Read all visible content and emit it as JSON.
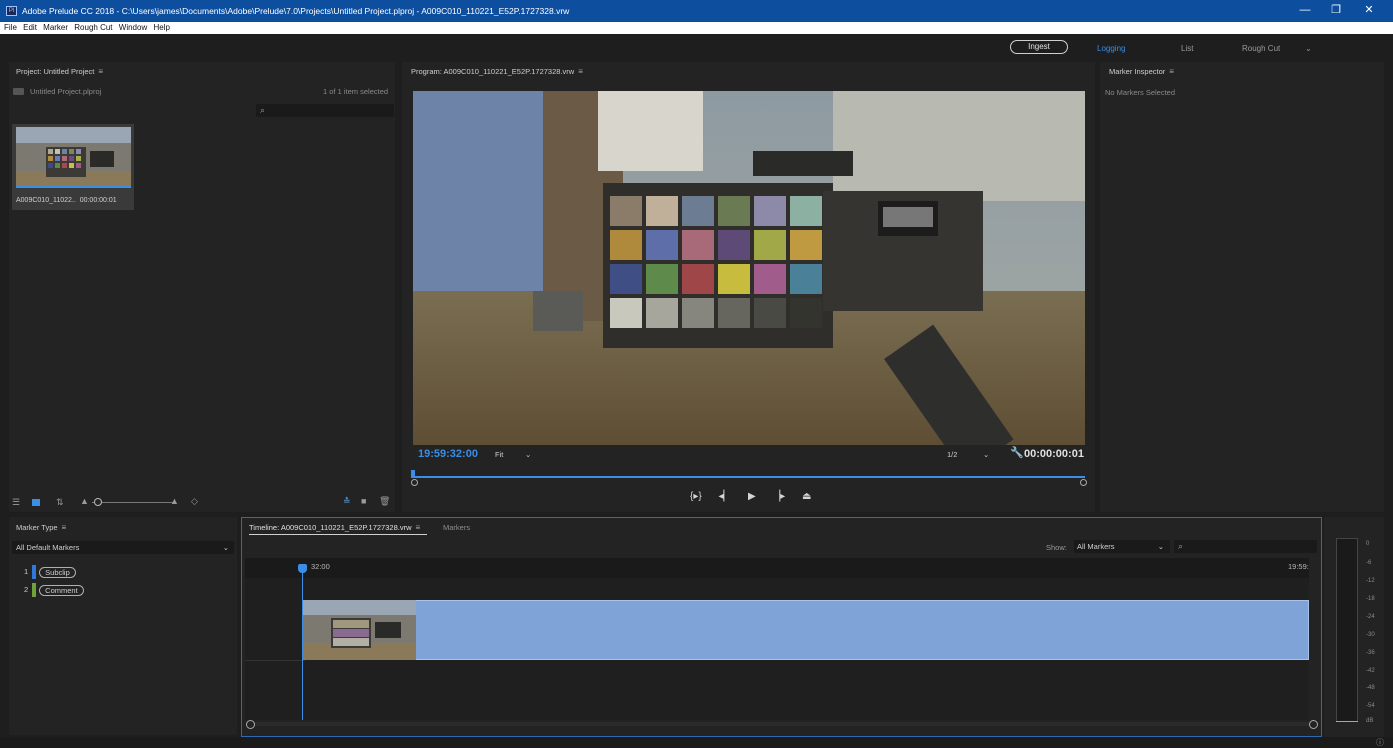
{
  "window": {
    "app_icon_label": "Pl",
    "title": "Adobe Prelude CC 2018 - C:\\Users\\james\\Documents\\Adobe\\Prelude\\7.0\\Projects\\Untitled Project.plproj - A009C010_110221_E52P.1727328.vrw",
    "controls": {
      "minimize": "—",
      "restore": "❐",
      "close": "✕"
    }
  },
  "menu": [
    "File",
    "Edit",
    "Marker",
    "Rough Cut",
    "Window",
    "Help"
  ],
  "workspaces": {
    "ingest_label": "Ingest",
    "tabs": [
      "Logging",
      "List",
      "Rough Cut"
    ],
    "active": "Logging",
    "more_icon": "chevron-down-icon",
    "accent_color": "#3a8ee6"
  },
  "project_panel": {
    "title": "Project: Untitled Project",
    "project_file": "Untitled Project.plproj",
    "selection_status": "1 of 1 item selected",
    "clip": {
      "name": "A009C010_11022..",
      "duration": "00:00:00:01"
    }
  },
  "program_panel": {
    "title": "Program: A009C010_110221_E52P.1727328.vrw",
    "timecode_current": "19:59:32:00",
    "zoom": "Fit",
    "resolution": "1/2",
    "timecode_duration": "00:00:00:01",
    "transport_icons": [
      "mark-in-out-icon",
      "step-back-icon",
      "play-icon",
      "step-forward-icon",
      "export-frame-icon"
    ]
  },
  "marker_inspector": {
    "title": "Marker Inspector",
    "empty_text": "No Markers Selected"
  },
  "marker_type_panel": {
    "title": "Marker Type",
    "selected_set": "All Default Markers",
    "markers": [
      {
        "index": "1",
        "label": "Subclip",
        "color": "#2f7ad8"
      },
      {
        "index": "2",
        "label": "Comment",
        "color": "#6fa23a"
      }
    ]
  },
  "timeline_panel": {
    "title": "Timeline: A009C010_110221_E52P.1727328.vrw",
    "markers_tab": "Markers",
    "show_label": "Show:",
    "show_value": "All Markers",
    "ruler_start": "32:00",
    "ruler_end": "19:59:",
    "clip_color": "#7fa3d6"
  },
  "audio_meter": {
    "db_scale": [
      "0",
      "-6",
      "-12",
      "-18",
      "-24",
      "-30",
      "-36",
      "-42",
      "-48",
      "-54",
      "dB"
    ]
  }
}
